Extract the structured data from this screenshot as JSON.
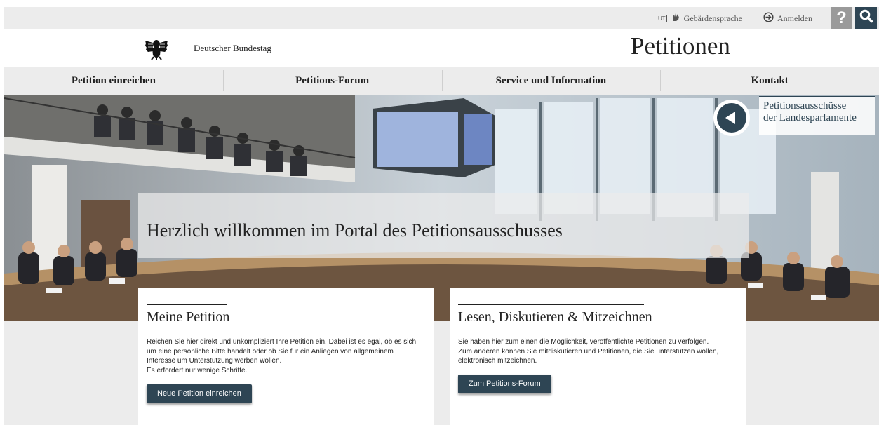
{
  "utility": {
    "sign_language_badge": "UT",
    "sign_language_label": "Gebärdensprache",
    "login_label": "Anmelden",
    "help_glyph": "?",
    "icons": [
      "ut-badge",
      "hand-icon",
      "login-arrow-icon",
      "help-icon",
      "search-icon"
    ]
  },
  "header": {
    "brand": "Deutscher Bundestag",
    "title": "Petitionen"
  },
  "nav": {
    "items": [
      {
        "label": "Petition einreichen"
      },
      {
        "label": "Petitions-Forum"
      },
      {
        "label": "Service und Information"
      },
      {
        "label": "Kontakt"
      }
    ]
  },
  "hero": {
    "welcome": "Herzlich willkommen im Portal des Petitionsausschusses",
    "landes_link": {
      "line1": "Petitionsausschüsse",
      "line2": "der Landesparlamente"
    }
  },
  "cards": [
    {
      "title": "Meine Petition",
      "lines": [
        "Reichen Sie hier direkt und unkompliziert Ihre Petition ein. Dabei ist es egal, ob es sich",
        "um eine persönliche Bitte handelt oder ob Sie für ein Anliegen von allgemeinem",
        "Interesse um Unterstützung werben wollen.",
        "Es erfordert nur wenige Schritte."
      ],
      "button": "Neue Petition einreichen"
    },
    {
      "title": "Lesen, Diskutieren & Mitzeichnen",
      "lines": [
        "Sie haben hier zum einen die Möglichkeit, veröffentlichte Petitionen zu verfolgen.",
        "Zum anderen können Sie mitdiskutieren und Petitionen, die Sie unterstützen wollen,",
        "elektronisch mitzeichnen."
      ],
      "button": "Zum Petitions-Forum"
    }
  ],
  "colors": {
    "accent": "#2e4554",
    "background": "#ececec",
    "help_button": "#9a9a9a"
  }
}
